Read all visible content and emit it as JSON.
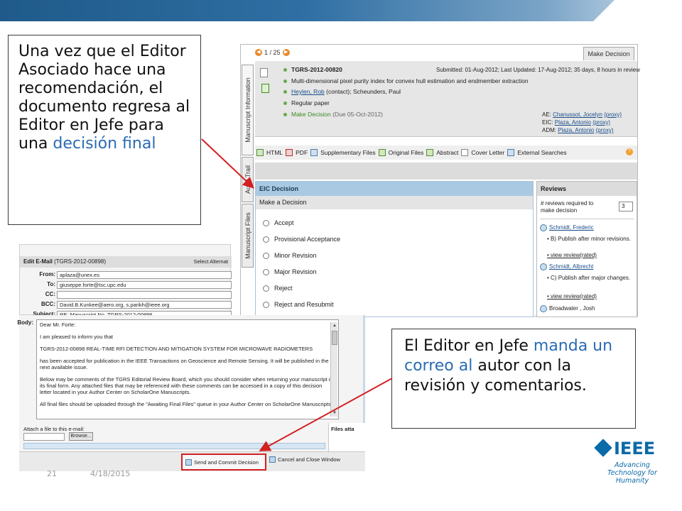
{
  "callouts": {
    "top": {
      "text": "Una vez que el Editor Asociado hace una recomendación, el documento regresa al Editor en Jefe para una ",
      "highlight": "decisión final"
    },
    "bottom": {
      "before": "El Editor en Jefe ",
      "highlight": "manda un correo al",
      "after": " autor con la revisión y comentarios."
    }
  },
  "manuscript": {
    "pager": "1 / 25",
    "make_decision_tab": "Make Decision",
    "side_tabs": [
      "Manuscript Information",
      "Audit Trail",
      "Manuscript Files"
    ],
    "id": "TGRS-2012-00820",
    "submitted": "Submitted: 01-Aug-2012; Last Updated: 17-Aug-2012; 35 days, 8 hours in review",
    "title": "Multi-dimensional pixel purity index for convex hull estimation and endmember extraction",
    "authors": {
      "contact": "Heylen, Rob",
      "contact_tag": "(contact);",
      "others": "Scheunders, Paul"
    },
    "paper_type": "Regular paper",
    "decision_status": "Make Decision",
    "decision_due": "(Due 05-Oct-2012)",
    "editors": [
      {
        "role": "AE:",
        "name": "Chanussot, Jocelyn",
        "proxy": "(proxy)"
      },
      {
        "role": "EIC:",
        "name": "Plaza, Antonio",
        "proxy": "(proxy)"
      },
      {
        "role": "ADM:",
        "name": "Plaza, Antonio",
        "proxy": "(proxy)"
      }
    ],
    "toolbar": [
      "HTML",
      "PDF",
      "Supplementary Files",
      "Original Files",
      "Abstract",
      "Cover Letter",
      "External Searches"
    ],
    "help_icon": "?"
  },
  "eic": {
    "header": "EIC Decision",
    "subheader": "Make a Decision",
    "options": [
      "Accept",
      "Provisional Acceptance",
      "Minor Revision",
      "Major Revision",
      "Reject",
      "Reject and Resubmit"
    ]
  },
  "reviews": {
    "header": "Reviews",
    "required_label": "# reviews required to make decision",
    "required_value": "3",
    "reviewers": [
      {
        "name": "Schmidt, Frederic",
        "recommendation": "• B) Publish after minor revisions.",
        "link": "• view review(rated)"
      },
      {
        "name": "Schmidt, Albrecht",
        "recommendation": "• C) Publish after major changes.",
        "link": "• view review(rated)"
      },
      {
        "name": "Broadwater , Josh"
      }
    ]
  },
  "email": {
    "title_bold": "Edit E-Mail",
    "title_id": "(TGRS-2012-00898)",
    "select_alt": "Select Alternat",
    "fields": [
      {
        "label": "From:",
        "value": "aplaza@unex.es"
      },
      {
        "label": "To:",
        "value": "giuseppe.forte@tsc.upc.edu"
      },
      {
        "label": "CC:",
        "value": ""
      },
      {
        "label": "BCC:",
        "value": "David.B.Kunkee@aero.org, s.parikh@ieee.org"
      },
      {
        "label": "Subject:",
        "value": "RE: Manuscript No. TGRS-2012-00898"
      }
    ],
    "body_label": "Body:",
    "body": [
      "Dear Mr. Forte:",
      "I am pleased to inform you that",
      "TGRS-2012-00898 REAL-TIME RFI DETECTION AND MITIGATION SYSTEM FOR MICROWAVE RADIOMETERS",
      "has been accepted for publication in the IEEE Transactions on Geoscience and Remote Sensing. It will be published in the next available issue.",
      "Below may be comments of the TGRS Editorial Review Board, which you should consider when returning your manuscript in its final form.  Any attached files that may be referenced with these comments can be accessed in a copy of this decision letter located in your Author Center on ScholarOne Manuscripts.",
      "All final files should be uploaded through the \"Awaiting Final Files\" queue in your Author Center on ScholarOne Manuscripts."
    ],
    "attach_label": "Attach a file to this e-mail:",
    "browse": "Browse...",
    "files_label": "Files atta",
    "send_button": "Send and Commit Decision",
    "cancel_button": "Cancel and Close Window"
  },
  "footer": {
    "slide_number": "21",
    "date": "4/18/2015"
  },
  "logo": {
    "wordmark": "IEEE",
    "tagline": "Advancing Technology for Humanity"
  },
  "colors": {
    "accent_blue": "#2a6bb3",
    "ieee_blue": "#0b6aa8",
    "highlight_red": "#d32020"
  }
}
